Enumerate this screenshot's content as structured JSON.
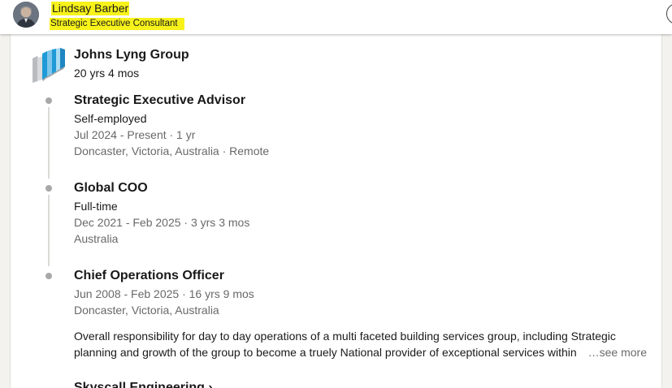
{
  "header": {
    "name": "Lindsay Barber",
    "headline": "Strategic Executive Consultant",
    "highlight_color": "#f7f21a"
  },
  "company": {
    "logo_icon": "johns-lyng-logo",
    "name": "Johns Lyng Group",
    "duration": "20 yrs 4 mos"
  },
  "roles": [
    {
      "title": "Strategic Executive Advisor",
      "employment_type": "Self-employed",
      "dates": "Jul 2024 - Present · 1 yr",
      "location": "Doncaster, Victoria, Australia · Remote"
    },
    {
      "title": "Global COO",
      "employment_type": "Full-time",
      "dates": "Dec 2021 - Feb 2025 · 3 yrs 3 mos",
      "location": "Australia"
    },
    {
      "title": "Chief Operations Officer",
      "dates": "Jun 2008 - Feb 2025 · 16 yrs 9 mos",
      "location": "Doncaster, Victoria, Australia",
      "description_line1": "Overall responsibility for day to day operations of a multi faceted building services group, including Strategic",
      "description_line2": "planning and growth of the group to become a truely National provider of exceptional services within",
      "see_more": "…see more"
    }
  ],
  "next_section_peek": "Skyscall Engineering  ›"
}
